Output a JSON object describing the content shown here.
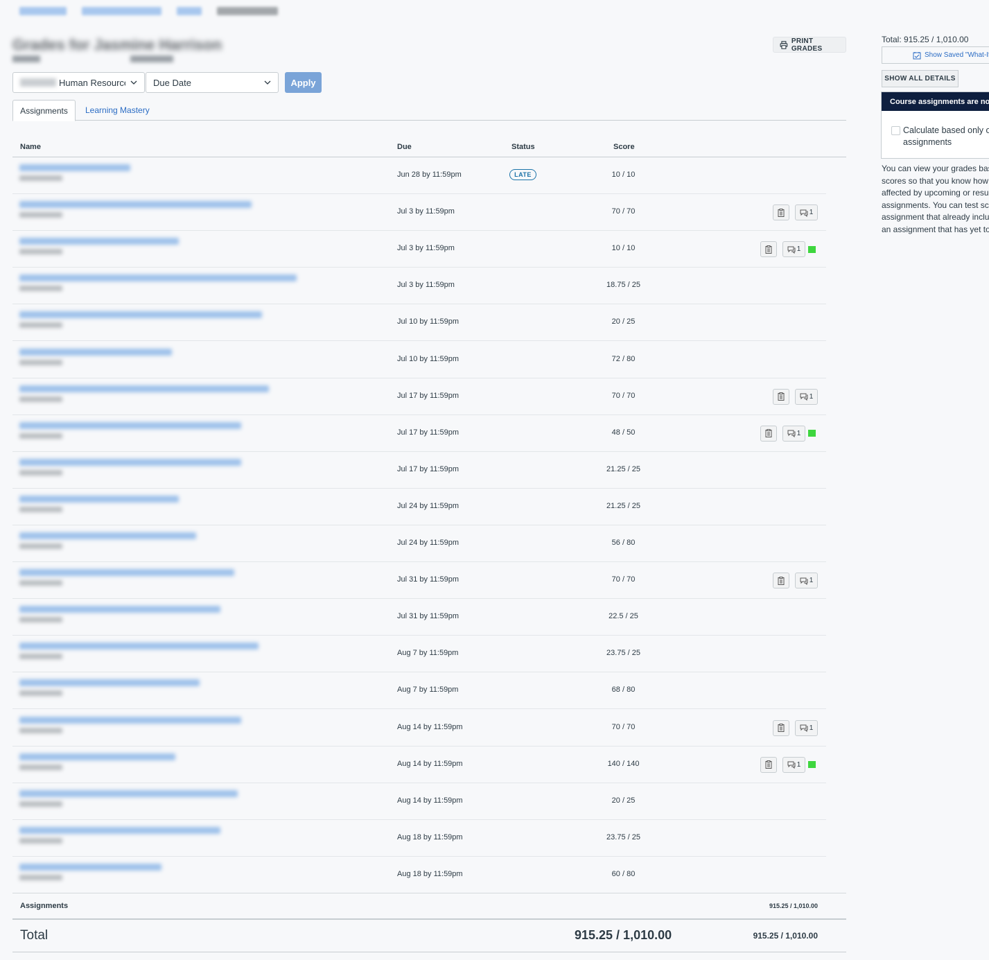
{
  "header": {
    "title": "Grades for Jasmine Harrison",
    "print_label": "PRINT GRADES",
    "course_select_value": "Human Resource",
    "sort_select_value": "Due Date",
    "apply_label": "Apply"
  },
  "tabs": [
    {
      "label": "Assignments"
    },
    {
      "label": "Learning Mastery"
    }
  ],
  "table": {
    "headers": {
      "name": "Name",
      "due": "Due",
      "status": "Status",
      "score": "Score"
    },
    "rows": [
      {
        "due": "Jun 28 by 11:59pm",
        "status": "LATE",
        "score": "10 / 10",
        "rubric": false,
        "comments": "",
        "flag": false
      },
      {
        "due": "Jul 3 by 11:59pm",
        "status": "",
        "score": "70 / 70",
        "rubric": true,
        "comments": "1",
        "flag": false
      },
      {
        "due": "Jul 3 by 11:59pm",
        "status": "",
        "score": "10 / 10",
        "rubric": true,
        "comments": "1",
        "flag": true
      },
      {
        "due": "Jul 3 by 11:59pm",
        "status": "",
        "score": "18.75 / 25",
        "rubric": false,
        "comments": "",
        "flag": false
      },
      {
        "due": "Jul 10 by 11:59pm",
        "status": "",
        "score": "20 / 25",
        "rubric": false,
        "comments": "",
        "flag": false
      },
      {
        "due": "Jul 10 by 11:59pm",
        "status": "",
        "score": "72 / 80",
        "rubric": false,
        "comments": "",
        "flag": false
      },
      {
        "due": "Jul 17 by 11:59pm",
        "status": "",
        "score": "70 / 70",
        "rubric": true,
        "comments": "1",
        "flag": false
      },
      {
        "due": "Jul 17 by 11:59pm",
        "status": "",
        "score": "48 / 50",
        "rubric": true,
        "comments": "1",
        "flag": true
      },
      {
        "due": "Jul 17 by 11:59pm",
        "status": "",
        "score": "21.25 / 25",
        "rubric": false,
        "comments": "",
        "flag": false
      },
      {
        "due": "Jul 24 by 11:59pm",
        "status": "",
        "score": "21.25 / 25",
        "rubric": false,
        "comments": "",
        "flag": false
      },
      {
        "due": "Jul 24 by 11:59pm",
        "status": "",
        "score": "56 / 80",
        "rubric": false,
        "comments": "",
        "flag": false
      },
      {
        "due": "Jul 31 by 11:59pm",
        "status": "",
        "score": "70 / 70",
        "rubric": true,
        "comments": "1",
        "flag": false
      },
      {
        "due": "Jul 31 by 11:59pm",
        "status": "",
        "score": "22.5 / 25",
        "rubric": false,
        "comments": "",
        "flag": false
      },
      {
        "due": "Aug 7 by 11:59pm",
        "status": "",
        "score": "23.75 / 25",
        "rubric": false,
        "comments": "",
        "flag": false
      },
      {
        "due": "Aug 7 by 11:59pm",
        "status": "",
        "score": "68 / 80",
        "rubric": false,
        "comments": "",
        "flag": false
      },
      {
        "due": "Aug 14 by 11:59pm",
        "status": "",
        "score": "70 / 70",
        "rubric": true,
        "comments": "1",
        "flag": false
      },
      {
        "due": "Aug 14 by 11:59pm",
        "status": "",
        "score": "140 / 140",
        "rubric": true,
        "comments": "1",
        "flag": true
      },
      {
        "due": "Aug 14 by 11:59pm",
        "status": "",
        "score": "20 / 25",
        "rubric": false,
        "comments": "",
        "flag": false
      },
      {
        "due": "Aug 18 by 11:59pm",
        "status": "",
        "score": "23.75 / 25",
        "rubric": false,
        "comments": "",
        "flag": false
      },
      {
        "due": "Aug 18 by 11:59pm",
        "status": "",
        "score": "60 / 80",
        "rubric": false,
        "comments": "",
        "flag": false
      }
    ],
    "group_label": "Assignments",
    "group_score": "915.25 / 1,010.00",
    "total_label": "Total",
    "total_score": "915.25 / 1,010.00",
    "total_score_right": "915.25 / 1,010.00"
  },
  "sidebar": {
    "total_text": "Total: 915.25 / 1,010.00",
    "saved_whatif_label": "Show Saved \"What-If\"",
    "show_all_label": "SHOW ALL DETAILS",
    "panel_header": "Course assignments are not",
    "checkbox_label_line1": "Calculate based only o",
    "checkbox_label_line2": "assignments",
    "note_lines": [
      "You can view your grades base",
      "scores so that you know how g",
      "affected by upcoming or resub",
      "assignments. You can test sco",
      "assignment that already incluc",
      "an assignment that has yet to"
    ]
  },
  "colors": {
    "accent": "#2b6cc4",
    "late": "#1c73a8",
    "flag": "#3ed63e",
    "panel_header": "#0e1f3f"
  }
}
